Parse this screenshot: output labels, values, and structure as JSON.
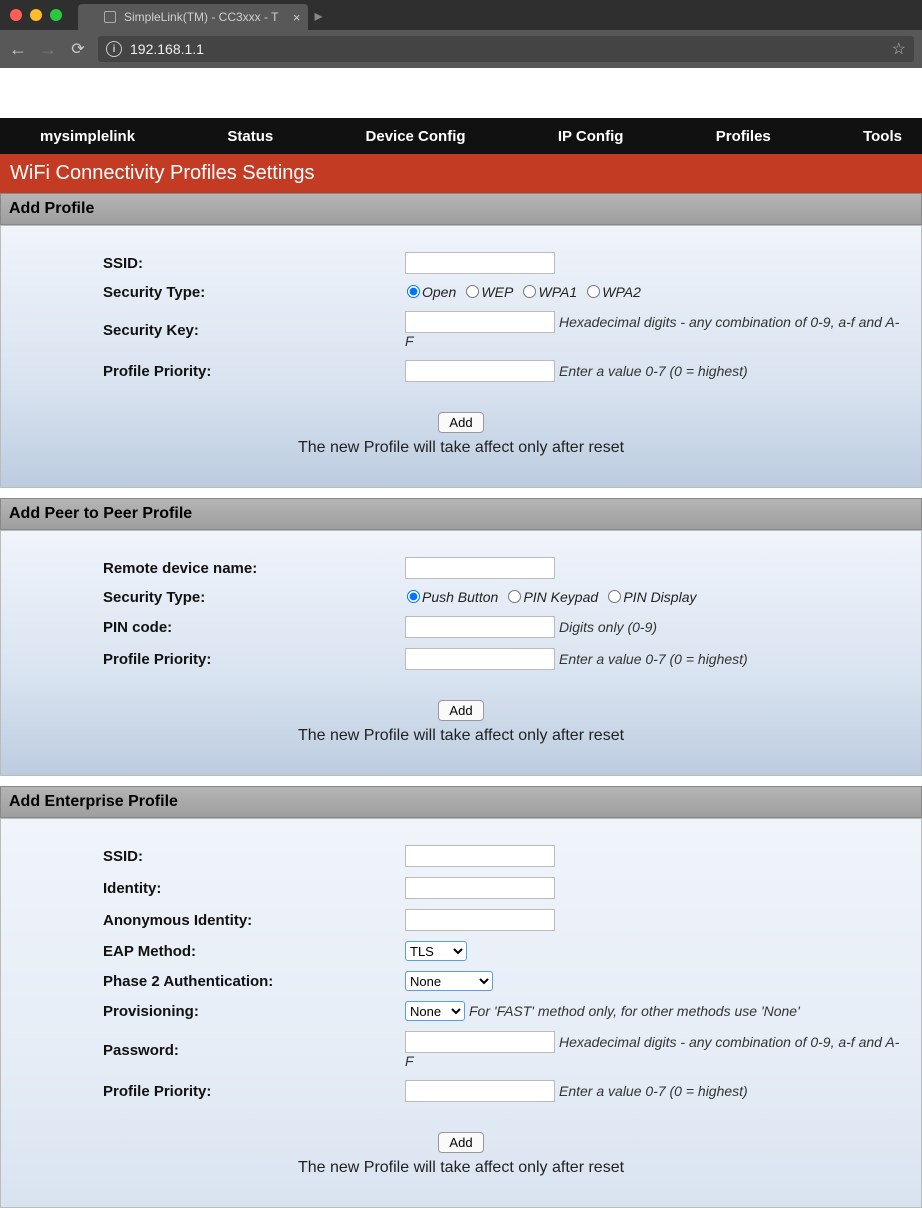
{
  "browser": {
    "tab_title": "SimpleLink(TM) - CC3xxx  - T",
    "url": "192.168.1.1"
  },
  "topnav": {
    "items": [
      "mysimplelink",
      "Status",
      "Device Config",
      "IP Config",
      "Profiles",
      "Tools"
    ]
  },
  "banner": {
    "title": "WiFi Connectivity Profiles Settings"
  },
  "add_profile": {
    "header": "Add Profile",
    "labels": {
      "ssid": "SSID:",
      "sec_type": "Security Type:",
      "sec_key": "Security Key:",
      "priority": "Profile Priority:"
    },
    "sec_options": [
      "Open",
      "WEP",
      "WPA1",
      "WPA2"
    ],
    "sec_selected": "Open",
    "hints": {
      "sec_key": "Hexadecimal digits - any combination of 0-9, a-f and A-F",
      "priority": "Enter a value 0-7 (0 = highest)"
    },
    "button": "Add",
    "footer": "The new Profile will take affect only after reset"
  },
  "p2p_profile": {
    "header": "Add Peer to Peer Profile",
    "labels": {
      "remote": "Remote device name:",
      "sec_type": "Security Type:",
      "pin": "PIN code:",
      "priority": "Profile Priority:"
    },
    "sec_options": [
      "Push Button",
      "PIN Keypad",
      "PIN Display"
    ],
    "sec_selected": "Push Button",
    "hints": {
      "pin": "Digits only (0-9)",
      "priority": "Enter a value 0-7 (0 = highest)"
    },
    "button": "Add",
    "footer": "The new Profile will take affect only after reset"
  },
  "ent_profile": {
    "header": "Add Enterprise Profile",
    "labels": {
      "ssid": "SSID:",
      "identity": "Identity:",
      "anon_identity": "Anonymous Identity:",
      "eap": "EAP Method:",
      "phase2": "Phase 2 Authentication:",
      "prov": "Provisioning:",
      "password": "Password:",
      "priority": "Profile Priority:"
    },
    "eap_value": "TLS",
    "phase2_value": "None",
    "prov_value": "None",
    "hints": {
      "prov": "For 'FAST' method only, for other methods use 'None'",
      "password": "Hexadecimal digits - any combination of 0-9, a-f and A-F",
      "priority": "Enter a value 0-7 (0 = highest)"
    },
    "button": "Add",
    "footer": "The new Profile will take affect only after reset"
  }
}
